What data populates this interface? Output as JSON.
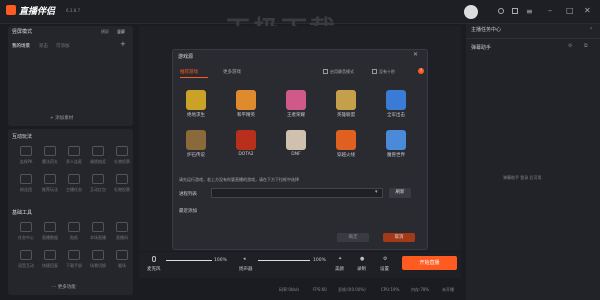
{
  "app": {
    "brand": "直播伴侣",
    "version": "6.3.8.7",
    "watermark": "天极下载"
  },
  "topbar": {
    "right_title": "主播任务中心"
  },
  "scene": {
    "mode": "竖屏模式",
    "actions": [
      "横屏",
      "竖屏"
    ],
    "tabs": [
      "我的场景",
      "双击",
      "可添加"
    ],
    "add_material": "+ 添加素材"
  },
  "interactive": {
    "title": "互动玩法",
    "items": [
      "连线PK",
      "魔法药丸",
      "多人连麦",
      "福袋抽奖",
      "礼物投票",
      "粉丝团",
      "推荐玩法",
      "主播任务",
      "互动红包",
      "礼物投票"
    ]
  },
  "tools": {
    "title": "基础工具",
    "items": [
      "任务中心",
      "直播数据",
      "贴纸",
      "本场直播",
      "直播间",
      "语音互动",
      "快捷回复",
      "下载手册",
      "场景切换",
      "暖场"
    ],
    "more": "··· 更多功能"
  },
  "dialog": {
    "title": "游戏源",
    "tabs": [
      "推荐游戏",
      "更多游戏"
    ],
    "checks": [
      "启用静音模式",
      "没有十秒",
      "?"
    ],
    "games": [
      [
        "绝地求生",
        "和平精英",
        "王者荣耀",
        "英雄联盟",
        "全军出击"
      ],
      [
        "炉石传说",
        "DOTA2",
        "DNF",
        "穿越火线",
        "魔兽世界"
      ]
    ],
    "hint": "请先运行游戏，若上方没有你要直播的游戏，请在下方下拉框中选择",
    "process_label": "进程列表",
    "refresh": "刷新",
    "recent": "最近添加",
    "cancel": "确定",
    "confirm": "取消"
  },
  "bottom": {
    "mic": "麦克风",
    "mic_vol": "100%",
    "speaker": "扬声器",
    "speaker_vol": "100%",
    "beauty": "美颜",
    "record": "录制",
    "settings": "设置",
    "start": "开始直播"
  },
  "status": {
    "bitrate": "码率:0kb/s",
    "fps": "FPS:60",
    "drop": "丢帧:0(0.00%)",
    "cpu": "CPU:19%",
    "mem": "内存:78%",
    "time": "未开播"
  },
  "right": {
    "title": "弹幕助手",
    "empty": "弹幕助手 登录 后可用"
  },
  "colors": {
    "accent": "#ff5a1f",
    "bg": "#1b1c21",
    "panel": "#25262c"
  }
}
